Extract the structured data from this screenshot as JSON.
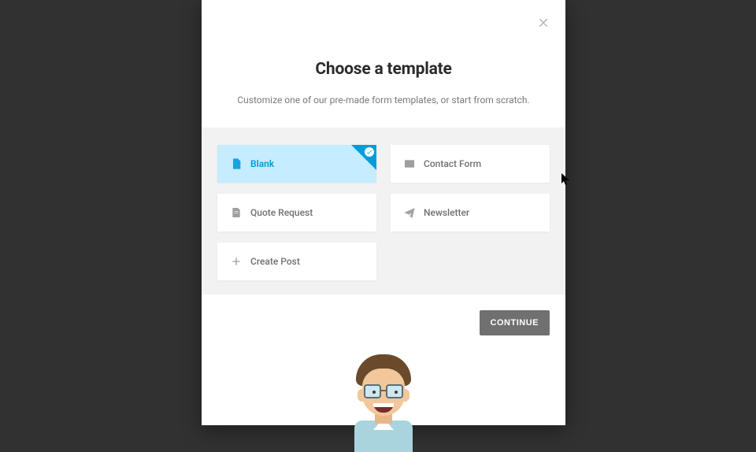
{
  "modal": {
    "title": "Choose a template",
    "subtitle": "Customize one of our pre-made form templates, or start from scratch.",
    "continue_label": "CONTINUE",
    "templates": [
      {
        "label": "Blank",
        "icon": "file-icon",
        "selected": true
      },
      {
        "label": "Contact Form",
        "icon": "mail-icon",
        "selected": false
      },
      {
        "label": "Quote Request",
        "icon": "document-icon",
        "selected": false
      },
      {
        "label": "Newsletter",
        "icon": "paper-plane-icon",
        "selected": false
      },
      {
        "label": "Create Post",
        "icon": "plus-icon",
        "selected": false
      }
    ]
  },
  "colors": {
    "brand": "#049cdb",
    "card_selected_bg": "#c5ecff",
    "button_bg": "#707070"
  }
}
